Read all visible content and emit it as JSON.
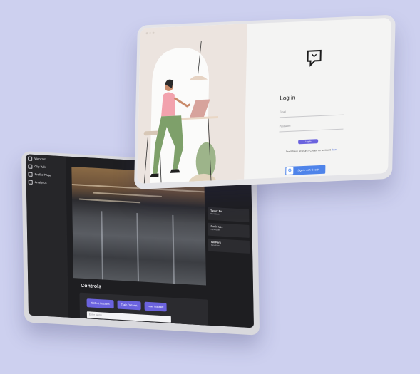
{
  "dashboard": {
    "sidebar": {
      "items": [
        {
          "label": "Webcam",
          "icon": "camera-icon"
        },
        {
          "label": "Clip Wiki",
          "icon": "book-icon"
        },
        {
          "label": "Profile Page",
          "icon": "user-icon"
        },
        {
          "label": "Analytics",
          "icon": "chart-icon"
        }
      ]
    },
    "people": [
      {
        "name": "Taylor Fu",
        "role": "Developer"
      },
      {
        "name": "David Lee",
        "role": "Developer"
      },
      {
        "name": "Ian Park",
        "role": "Developer"
      }
    ],
    "controls": {
      "title": "Controls",
      "buttons": [
        "Collect Dataset",
        "Train Dataset",
        "Load Dataset"
      ],
      "name_placeholder": "Enter Name"
    }
  },
  "login": {
    "title": "Log in",
    "email_placeholder": "Email",
    "password_placeholder": "Password",
    "login_button": "Log in",
    "signup_text": "Don't have account? Create an account",
    "signup_link": "here.",
    "google_button": "Sign in with Google",
    "accent": "#6b63de",
    "google_blue": "#4f84ea"
  }
}
